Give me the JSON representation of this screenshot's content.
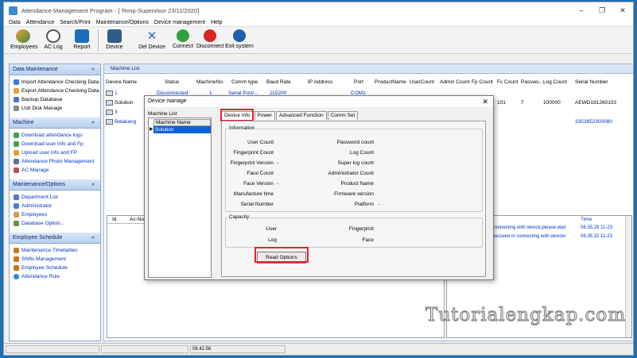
{
  "window": {
    "title": "Attendance Management Program - [ Temp-Supervisor 23/11/2020]"
  },
  "menu": [
    "Data",
    "Attendance",
    "Search/Print",
    "Maintenance/Options",
    "Device management",
    "Help"
  ],
  "toolbar": {
    "employees": "Employees",
    "aclog": "AC Log",
    "report": "Report",
    "device": "Device",
    "del_device": "Del Device",
    "connect": "Connect",
    "disconnect": "Disconnect",
    "exit": "Exit system"
  },
  "sidebar": {
    "data_maintenance": {
      "title": "Data Maintenance",
      "items": [
        "Import Attendance Checking Data",
        "Export Attendance Checking Data",
        "Backup Database",
        "Usb Disk Manage"
      ]
    },
    "machine": {
      "title": "Machine",
      "items": [
        "Download attendance logs",
        "Download user info and Fp",
        "Upload user info and FP",
        "Attendance Photo Management",
        "AC Manage"
      ]
    },
    "maintenance": {
      "title": "Maintenance/Options",
      "items": [
        "Department List",
        "Administrator",
        "Employees",
        "Database Option..."
      ]
    },
    "schedule": {
      "title": "Employee Schedule",
      "items": [
        "Maintenance Timetables",
        "Shifts Management",
        "Employee Schedule",
        "Attendance Rule"
      ]
    }
  },
  "main": {
    "tab": "Machine List",
    "headers": [
      "Device Name",
      "Status",
      "MachineNo.",
      "Comm type",
      "Baud Rate",
      "IP Address",
      "Port",
      "ProductName",
      "UserCount",
      "Admin Count",
      "Fp Count",
      "Fc Count",
      "Passwo...",
      "Log Count",
      "Serial Number"
    ],
    "rows": [
      {
        "name": "1",
        "status": "Disconnected",
        "machine_no": "1",
        "comm": "Serial Port/...",
        "baud": "115200",
        "port": "COM1",
        "fc": "",
        "pw": "",
        "log": "",
        "serial": ""
      },
      {
        "name": "Solution",
        "status": "",
        "machine_no": "",
        "comm": "",
        "baud": "",
        "port": "",
        "fc": "101",
        "pw": "7",
        "log": "100000",
        "serial": "AEWD191260103"
      },
      {
        "name": "3",
        "status": "",
        "machine_no": "",
        "comm": "",
        "baud": "",
        "port": "",
        "fc": "",
        "pw": "",
        "log": "",
        "serial": ""
      },
      {
        "name": "Belakang",
        "status": "",
        "machine_no": "",
        "comm": "",
        "baud": "",
        "port": "",
        "fc": "",
        "pw": "",
        "log": "",
        "serial": "3353852300080"
      }
    ],
    "lower_headers": [
      "Id",
      "Ac-No"
    ],
    "log_header": "Time",
    "logs": [
      {
        "msg": "Connecting with device,please wait",
        "time": "08.35.29 11-23"
      },
      {
        "msg": "Succeed in connecting with device!",
        "time": "08.35.32 11-23"
      }
    ]
  },
  "statusbar": {
    "time": "08.42.56"
  },
  "dialog": {
    "title": "Device manage",
    "machine_list_label": "Machine List",
    "machine_name_header": "Machine Name",
    "machine_selected": "Solution",
    "tabs": [
      "Device Info",
      "Power",
      "Advanced Function",
      "Comm Set"
    ],
    "information_title": "Information",
    "info_left": [
      {
        "label": "User Count",
        "value": ""
      },
      {
        "label": "Fingerprint Count",
        "value": ""
      },
      {
        "label": "Fingerprint Version",
        "value": "-"
      },
      {
        "label": "Face Count",
        "value": ""
      },
      {
        "label": "Face Version",
        "value": "-"
      },
      {
        "label": "Manufacture time",
        "value": ""
      },
      {
        "label": "Serial Number",
        "value": ""
      }
    ],
    "info_right": [
      {
        "label": "Password count",
        "value": ""
      },
      {
        "label": "Log Count",
        "value": ""
      },
      {
        "label": "Super log count",
        "value": ""
      },
      {
        "label": "Administrator Count",
        "value": ""
      },
      {
        "label": "Product Name",
        "value": ""
      },
      {
        "label": "Firmware version",
        "value": ""
      },
      {
        "label": "Platform",
        "value": "-"
      }
    ],
    "capacity_title": "Capacity",
    "cap_left": [
      "User",
      "Log"
    ],
    "cap_right": [
      "Fingerprint",
      "Face"
    ],
    "read_options": "Read Options",
    "close": "✕"
  },
  "watermark": "Tutorialengkap.com",
  "colors": {
    "highlight": "#e8232a",
    "desktop": "#1e6fb5",
    "selection": "#0a64d8"
  }
}
